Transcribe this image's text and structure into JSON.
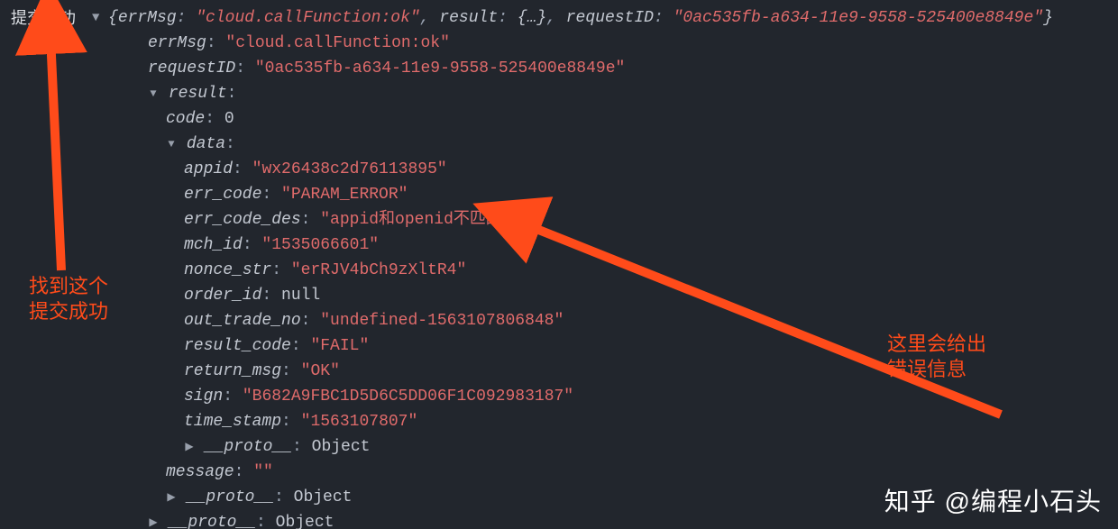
{
  "console": {
    "topLabel": "提交成功",
    "summary": {
      "errMsg": "cloud.callFunction:ok",
      "resultPlaceholder": "{…}",
      "requestID": "0ac535fb-a634-11e9-9558-525400e8849e"
    },
    "errMsg": "cloud.callFunction:ok",
    "requestID": "0ac535fb-a634-11e9-9558-525400e8849e",
    "result": {
      "code": "0",
      "data": {
        "appid": "wx26438c2d76113895",
        "err_code": "PARAM_ERROR",
        "err_code_des": "appid和openid不匹配",
        "mch_id": "1535066601",
        "nonce_str": "erRJV4bCh9zXltR4",
        "order_id": "null",
        "out_trade_no": "undefined-1563107806848",
        "result_code": "FAIL",
        "return_msg": "OK",
        "sign": "B682A9FBC1D5D6C5DD06F1C092983187",
        "time_stamp": "1563107807"
      },
      "message": "\"\"",
      "proto2": "Object",
      "proto1": "Object"
    },
    "proto0": "Object"
  },
  "annotations": {
    "left": "找到这个\n提交成功",
    "right": "这里会给出\n错误信息"
  },
  "watermark": "知乎 @编程小石头"
}
